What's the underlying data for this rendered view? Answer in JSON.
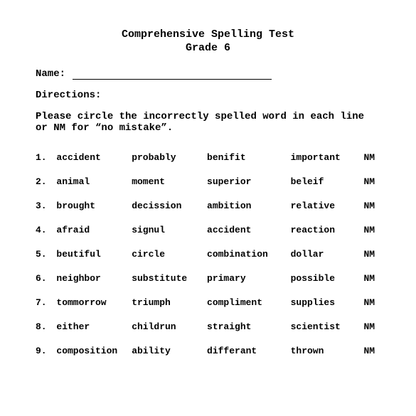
{
  "title": "Comprehensive Spelling Test",
  "subtitle": "Grade 6",
  "name_label": "Name:",
  "directions_label": "Directions:",
  "directions_text": "Please circle the incorrectly spelled word in each line or NM for “no mistake”.",
  "nm_label": "NM",
  "questions": [
    {
      "num": "1.",
      "words": [
        "accident",
        "probably",
        "benifit",
        "important"
      ]
    },
    {
      "num": "2.",
      "words": [
        "animal",
        "moment",
        "superior",
        "beleif"
      ]
    },
    {
      "num": "3.",
      "words": [
        "brought",
        "decission",
        "ambition",
        "relative"
      ]
    },
    {
      "num": "4.",
      "words": [
        "afraid",
        "signul",
        "accident",
        "reaction"
      ]
    },
    {
      "num": "5.",
      "words": [
        "beutiful",
        "circle",
        "combination",
        "dollar"
      ]
    },
    {
      "num": "6.",
      "words": [
        "neighbor",
        "substitute",
        "primary",
        "possible"
      ]
    },
    {
      "num": "7.",
      "words": [
        "tommorrow",
        "triumph",
        "compliment",
        "supplies"
      ]
    },
    {
      "num": "8.",
      "words": [
        "either",
        "childrun",
        "straight",
        "scientist"
      ]
    },
    {
      "num": "9.",
      "words": [
        "composition",
        "ability",
        "differant",
        "thrown"
      ]
    }
  ]
}
